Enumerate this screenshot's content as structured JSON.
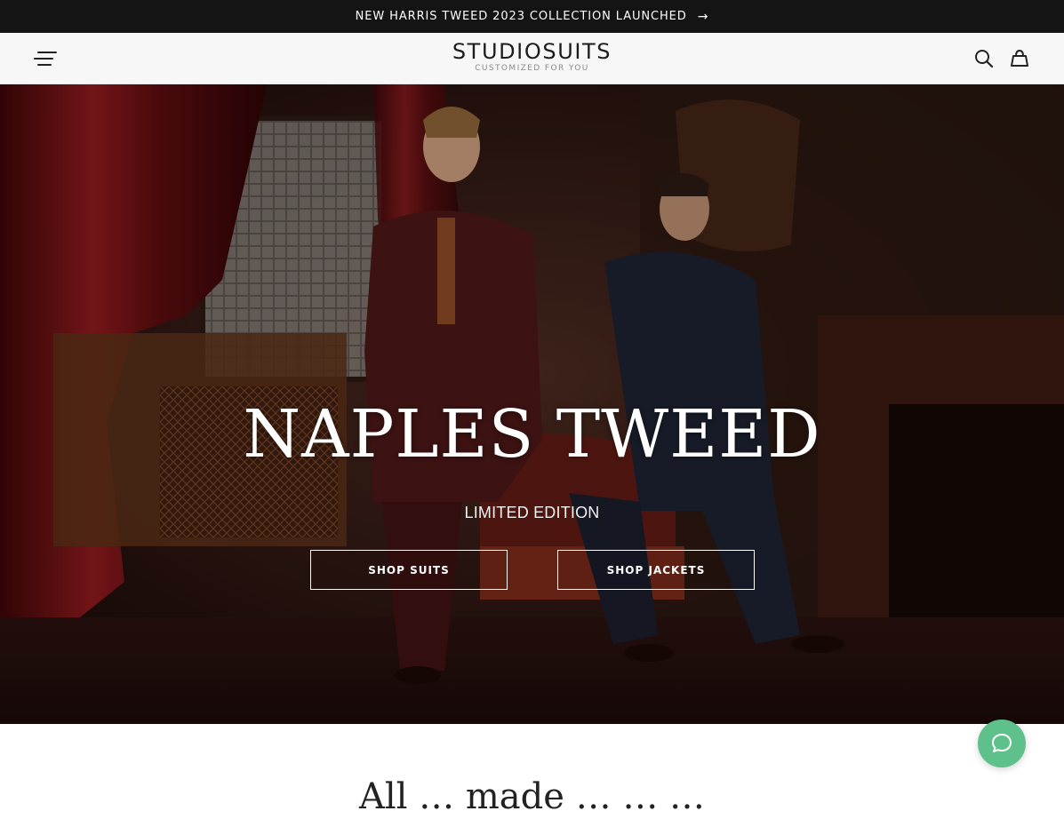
{
  "announcement": {
    "text": "NEW HARRIS TWEED 2023 COLLECTION LAUNCHED",
    "arrow": "→"
  },
  "header": {
    "brand": "STUDIOSUITS",
    "tagline": "CUSTOMIZED FOR YOU",
    "icons": [
      "menu-icon",
      "search-icon",
      "shopping-bag-icon"
    ]
  },
  "hero": {
    "title": "NAPLES TWEED",
    "subtitle": "LIMITED EDITION",
    "buttons": {
      "suits": "SHOP SUITS",
      "jackets": "SHOP JACKETS"
    }
  },
  "section": {
    "heading_peek": "All … made … … …"
  },
  "chat": {
    "icon": "chat-bubble-icon"
  },
  "colors": {
    "announcement_bg": "#141414",
    "header_bg": "#f7f7f7",
    "chat_accent": "#5ec08a",
    "hero_tone": "#3a1a12"
  }
}
